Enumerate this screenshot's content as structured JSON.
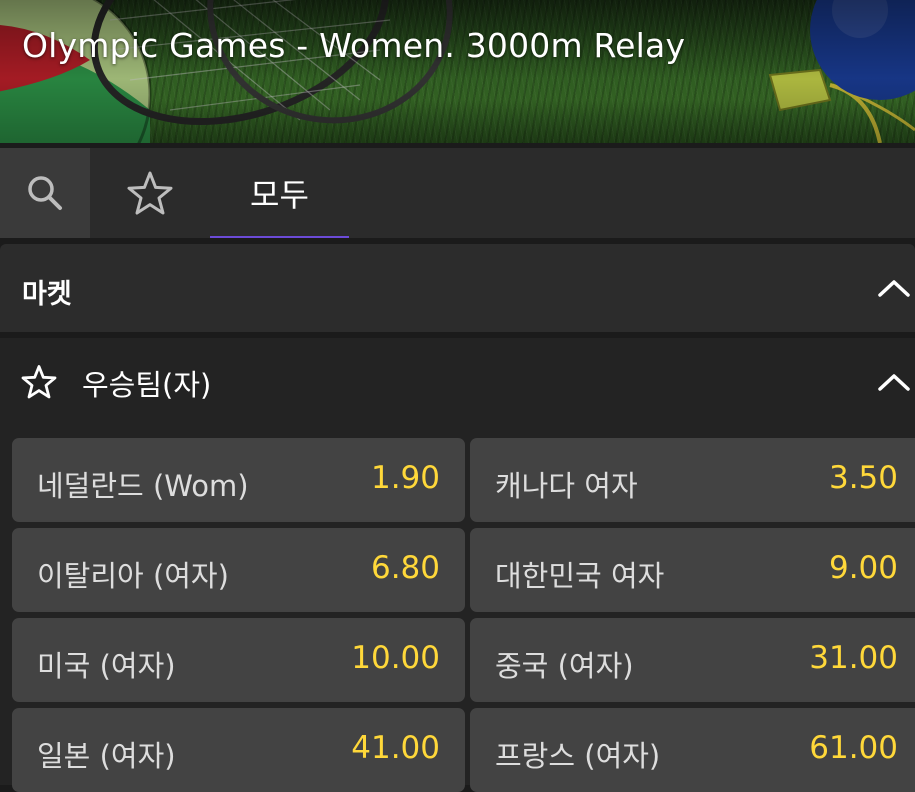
{
  "header": {
    "title": "Olympic Games - Women. 3000m Relay"
  },
  "tabs": {
    "search_icon": "search-icon",
    "favorites_icon": "star-icon",
    "all_label": "모두"
  },
  "market": {
    "label": "마켓",
    "chevron_icon": "chevron-up-icon"
  },
  "group": {
    "label": "우승팀(자)",
    "star_icon": "star-icon",
    "chevron_icon": "chevron-up-icon"
  },
  "odds": [
    {
      "name": "네덜란드 (Wom)",
      "price": "1.90"
    },
    {
      "name": "캐나다 여자",
      "price": "3.50"
    },
    {
      "name": "이탈리아 (여자)",
      "price": "6.80"
    },
    {
      "name": "대한민국 여자",
      "price": "9.00"
    },
    {
      "name": "미국 (여자)",
      "price": "10.00"
    },
    {
      "name": "중국 (여자)",
      "price": "31.00"
    },
    {
      "name": "일본 (여자)",
      "price": "41.00"
    },
    {
      "name": "프랑스 (여자)",
      "price": "61.00"
    }
  ],
  "colors": {
    "accent": "#6c4bd8",
    "price": "#ffd83a",
    "button_bg": "#434343"
  }
}
